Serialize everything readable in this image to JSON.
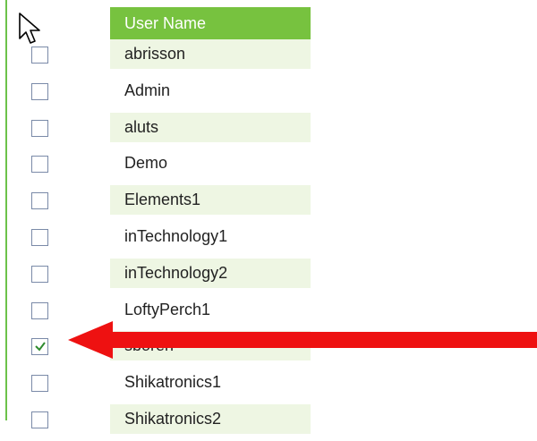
{
  "header": {
    "column_label": "User Name"
  },
  "users": [
    {
      "name": "abrisson",
      "checked": false
    },
    {
      "name": "Admin",
      "checked": false
    },
    {
      "name": "aluts",
      "checked": false
    },
    {
      "name": "Demo",
      "checked": false
    },
    {
      "name": "Elements1",
      "checked": false
    },
    {
      "name": "inTechnology1",
      "checked": false
    },
    {
      "name": "inTechnology2",
      "checked": false
    },
    {
      "name": "LoftyPerch1",
      "checked": false
    },
    {
      "name": "sboren",
      "checked": true
    },
    {
      "name": "Shikatronics1",
      "checked": false
    },
    {
      "name": "Shikatronics2",
      "checked": false
    }
  ],
  "colors": {
    "header_bg": "#77c23f",
    "row_alt_bg": "#eef6e3",
    "annotation_arrow": "#ee1111"
  },
  "icons": {
    "cursor": "arrow-cursor-icon",
    "annotation": "red-arrow-icon"
  }
}
